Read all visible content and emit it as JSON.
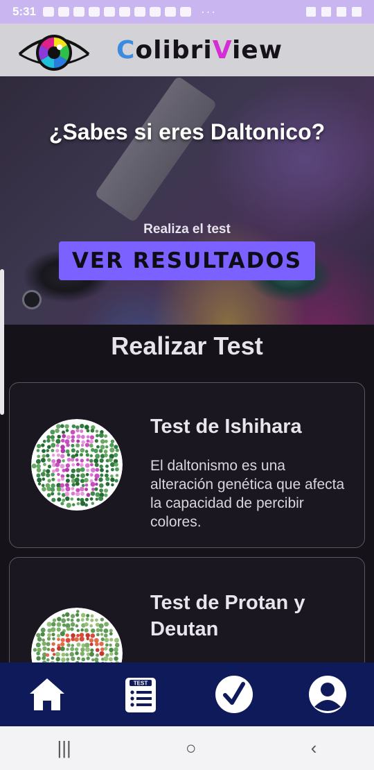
{
  "status_bar": {
    "time": "5:31",
    "dots": "···"
  },
  "header": {
    "brand_c": "C",
    "brand_1": "olibri",
    "brand_v": "V",
    "brand_2": "iew"
  },
  "hero": {
    "title": "¿Sabes si eres Daltonico?",
    "subtitle": "Realiza el test",
    "button_label": "VER RESULTADOS"
  },
  "main": {
    "section_title": "Realizar Test",
    "cards": [
      {
        "title": "Test de Ishihara",
        "description": "El daltonismo es una alteración genética que afecta la capacidad de percibir colores."
      },
      {
        "title": "Test de Protan y Deutan",
        "description": ""
      }
    ]
  },
  "bottom_nav": {
    "items": [
      "home-icon",
      "test-list-icon",
      "check-icon",
      "profile-icon"
    ]
  },
  "system_nav": {
    "recents": "|||",
    "home": "○",
    "back": "‹"
  },
  "colors": {
    "accent": "#7b61ff",
    "nav_bg": "#0e1a5a",
    "status_bg": "#c9b6f0",
    "header_bg": "#d3d3d7"
  }
}
